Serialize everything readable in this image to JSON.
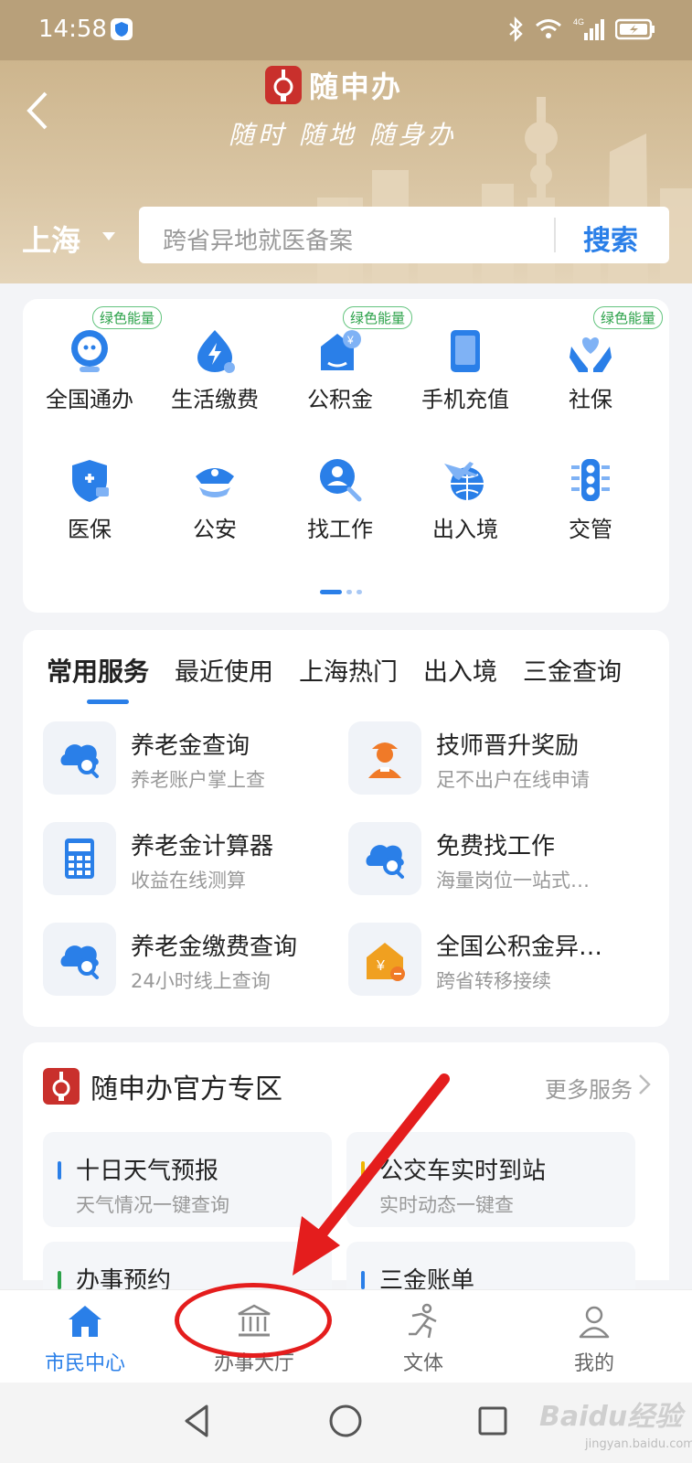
{
  "status_bar": {
    "time": "14:58"
  },
  "header": {
    "app_name": "随申办",
    "slogan": "随时 随地 随身办",
    "city": "上海",
    "search_placeholder": "跨省异地就医备案",
    "search_button": "搜索"
  },
  "grid": {
    "items": [
      {
        "label": "全国通办",
        "badge": "绿色能量",
        "icon": "globe-robot-icon"
      },
      {
        "label": "生活缴费",
        "badge": "",
        "icon": "lightning-drop-icon"
      },
      {
        "label": "公积金",
        "badge": "绿色能量",
        "icon": "house-yen-icon"
      },
      {
        "label": "手机充值",
        "badge": "",
        "icon": "phone-icon"
      },
      {
        "label": "社保",
        "badge": "绿色能量",
        "icon": "hands-heart-icon"
      },
      {
        "label": "医保",
        "badge": "",
        "icon": "medical-shield-icon"
      },
      {
        "label": "公安",
        "badge": "",
        "icon": "police-cap-icon"
      },
      {
        "label": "找工作",
        "badge": "",
        "icon": "person-search-icon"
      },
      {
        "label": "出入境",
        "badge": "",
        "icon": "plane-globe-icon"
      },
      {
        "label": "交管",
        "badge": "",
        "icon": "traffic-light-icon"
      }
    ]
  },
  "services": {
    "tabs": [
      "常用服务",
      "最近使用",
      "上海热门",
      "出入境",
      "三金查询"
    ],
    "items": [
      {
        "title": "养老金查询",
        "subtitle": "养老账户掌上查",
        "icon": "cloud-search-icon"
      },
      {
        "title": "技师晋升奖励",
        "subtitle": "足不出户在线申请",
        "icon": "worker-icon"
      },
      {
        "title": "养老金计算器",
        "subtitle": "收益在线测算",
        "icon": "calculator-icon"
      },
      {
        "title": "免费找工作",
        "subtitle": "海量岗位一站式…",
        "icon": "cloud-search-icon"
      },
      {
        "title": "养老金缴费查询",
        "subtitle": "24小时线上查询",
        "icon": "cloud-search-icon"
      },
      {
        "title": "全国公积金异…",
        "subtitle": "跨省转移接续",
        "icon": "house-yen-icon"
      }
    ]
  },
  "zone": {
    "title": "随申办官方专区",
    "more": "更多服务",
    "items": [
      {
        "title": "十日天气预报",
        "subtitle": "天气情况一键查询",
        "color": "#2a7fe8"
      },
      {
        "title": "公交车实时到站",
        "subtitle": "实时动态一键查",
        "color": "#f0b400"
      },
      {
        "title": "办事预约",
        "subtitle": "",
        "color": "#2ca24a"
      },
      {
        "title": "三金账单",
        "subtitle": "",
        "color": "#2a7fe8"
      }
    ]
  },
  "tabbar": {
    "items": [
      {
        "label": "市民中心",
        "icon": "home-icon",
        "active": true
      },
      {
        "label": "办事大厅",
        "icon": "bank-building-icon",
        "active": false
      },
      {
        "label": "文体",
        "icon": "running-person-icon",
        "active": false
      },
      {
        "label": "我的",
        "icon": "user-icon",
        "active": false
      }
    ]
  },
  "watermark": {
    "brand": "Baidu经验",
    "url": "jingyan.baidu.com"
  },
  "colors": {
    "accent": "#2a7fe8",
    "header_gold": "#cdb58d",
    "annotation_red": "#e41d1d",
    "green_badge": "#2ca24a"
  }
}
